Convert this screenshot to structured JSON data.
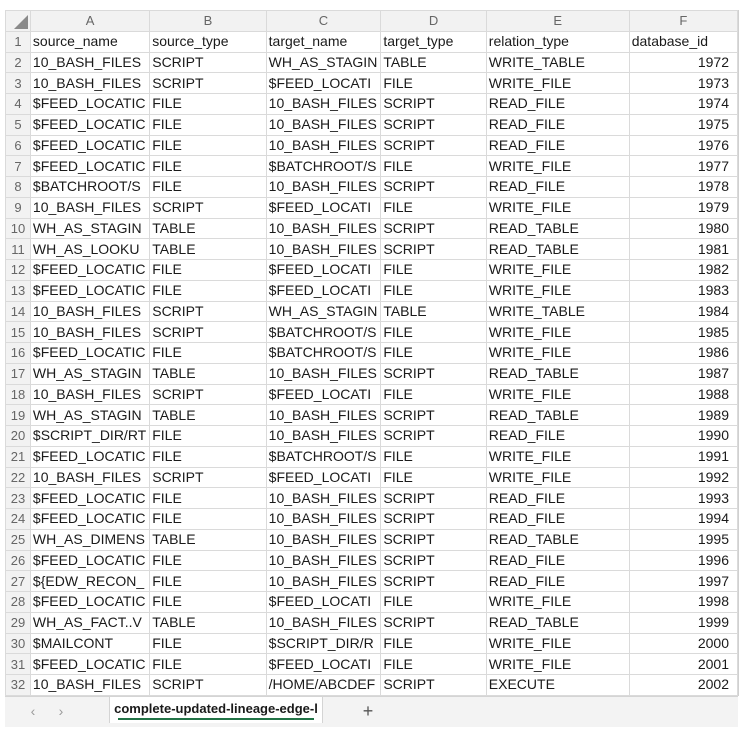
{
  "columns": [
    "A",
    "B",
    "C",
    "D",
    "E",
    "F"
  ],
  "header_row": [
    "source_name",
    "source_type",
    "target_name",
    "target_type",
    "relation_type",
    "database_id"
  ],
  "rows": [
    [
      "10_BASH_FILES",
      "SCRIPT",
      "WH_AS_STAGIN",
      "TABLE",
      "WRITE_TABLE",
      "1972"
    ],
    [
      "10_BASH_FILES",
      "SCRIPT",
      "$FEED_LOCATI",
      "FILE",
      "WRITE_FILE",
      "1973"
    ],
    [
      "$FEED_LOCATIC",
      "FILE",
      "10_BASH_FILES",
      "SCRIPT",
      "READ_FILE",
      "1974"
    ],
    [
      "$FEED_LOCATIC",
      "FILE",
      "10_BASH_FILES",
      "SCRIPT",
      "READ_FILE",
      "1975"
    ],
    [
      "$FEED_LOCATIC",
      "FILE",
      "10_BASH_FILES",
      "SCRIPT",
      "READ_FILE",
      "1976"
    ],
    [
      "$FEED_LOCATIC",
      "FILE",
      "$BATCHROOT/S",
      "FILE",
      "WRITE_FILE",
      "1977"
    ],
    [
      "$BATCHROOT/S",
      "FILE",
      "10_BASH_FILES",
      "SCRIPT",
      "READ_FILE",
      "1978"
    ],
    [
      "10_BASH_FILES",
      "SCRIPT",
      "$FEED_LOCATI",
      "FILE",
      "WRITE_FILE",
      "1979"
    ],
    [
      "WH_AS_STAGIN",
      "TABLE",
      "10_BASH_FILES",
      "SCRIPT",
      "READ_TABLE",
      "1980"
    ],
    [
      "WH_AS_LOOKU",
      "TABLE",
      "10_BASH_FILES",
      "SCRIPT",
      "READ_TABLE",
      "1981"
    ],
    [
      "$FEED_LOCATIC",
      "FILE",
      "$FEED_LOCATI",
      "FILE",
      "WRITE_FILE",
      "1982"
    ],
    [
      "$FEED_LOCATIC",
      "FILE",
      "$FEED_LOCATI",
      "FILE",
      "WRITE_FILE",
      "1983"
    ],
    [
      "10_BASH_FILES",
      "SCRIPT",
      "WH_AS_STAGIN",
      "TABLE",
      "WRITE_TABLE",
      "1984"
    ],
    [
      "10_BASH_FILES",
      "SCRIPT",
      "$BATCHROOT/S",
      "FILE",
      "WRITE_FILE",
      "1985"
    ],
    [
      "$FEED_LOCATIC",
      "FILE",
      "$BATCHROOT/S",
      "FILE",
      "WRITE_FILE",
      "1986"
    ],
    [
      "WH_AS_STAGIN",
      "TABLE",
      "10_BASH_FILES",
      "SCRIPT",
      "READ_TABLE",
      "1987"
    ],
    [
      "10_BASH_FILES",
      "SCRIPT",
      "$FEED_LOCATI",
      "FILE",
      "WRITE_FILE",
      "1988"
    ],
    [
      " WH_AS_STAGIN",
      "TABLE",
      "10_BASH_FILES",
      "SCRIPT",
      "READ_TABLE",
      "1989"
    ],
    [
      "$SCRIPT_DIR/RT",
      "FILE",
      "10_BASH_FILES",
      "SCRIPT",
      "READ_FILE",
      "1990"
    ],
    [
      "$FEED_LOCATIC",
      "FILE",
      "$BATCHROOT/S",
      "FILE",
      "WRITE_FILE",
      "1991"
    ],
    [
      "10_BASH_FILES",
      "SCRIPT",
      "$FEED_LOCATI",
      "FILE",
      "WRITE_FILE",
      "1992"
    ],
    [
      "$FEED_LOCATIC",
      "FILE",
      "10_BASH_FILES",
      "SCRIPT",
      "READ_FILE",
      "1993"
    ],
    [
      "$FEED_LOCATIC",
      "FILE",
      "10_BASH_FILES",
      "SCRIPT",
      "READ_FILE",
      "1994"
    ],
    [
      "WH_AS_DIMENS",
      "TABLE",
      "10_BASH_FILES",
      "SCRIPT",
      "READ_TABLE",
      "1995"
    ],
    [
      "$FEED_LOCATIC",
      "FILE",
      "10_BASH_FILES",
      "SCRIPT",
      "READ_FILE",
      "1996"
    ],
    [
      "${EDW_RECON_",
      "FILE",
      "10_BASH_FILES",
      "SCRIPT",
      "READ_FILE",
      "1997"
    ],
    [
      "$FEED_LOCATIC",
      "FILE",
      "$FEED_LOCATI",
      "FILE",
      "WRITE_FILE",
      "1998"
    ],
    [
      " WH_AS_FACT..V",
      "TABLE",
      "10_BASH_FILES",
      "SCRIPT",
      "READ_TABLE",
      "1999"
    ],
    [
      "$MAILCONT",
      "FILE",
      "$SCRIPT_DIR/R",
      "FILE",
      "WRITE_FILE",
      "2000"
    ],
    [
      "$FEED_LOCATIC",
      "FILE",
      "$FEED_LOCATI",
      "FILE",
      "WRITE_FILE",
      "2001"
    ],
    [
      "10_BASH_FILES",
      "SCRIPT",
      "/HOME/ABCDEF",
      "SCRIPT",
      "EXECUTE",
      "2002"
    ]
  ],
  "sheet_tab": {
    "label": "complete-updated-lineage-edge-l",
    "prev_icon": "chevron-left-icon",
    "next_icon": "chevron-right-icon",
    "add_icon": "plus-icon",
    "prev_glyph": "‹",
    "next_glyph": "›",
    "add_glyph": "+"
  },
  "colors": {
    "header_bg": "#f2f2f2",
    "grid": "#dadada",
    "tab_accent": "#217346"
  }
}
